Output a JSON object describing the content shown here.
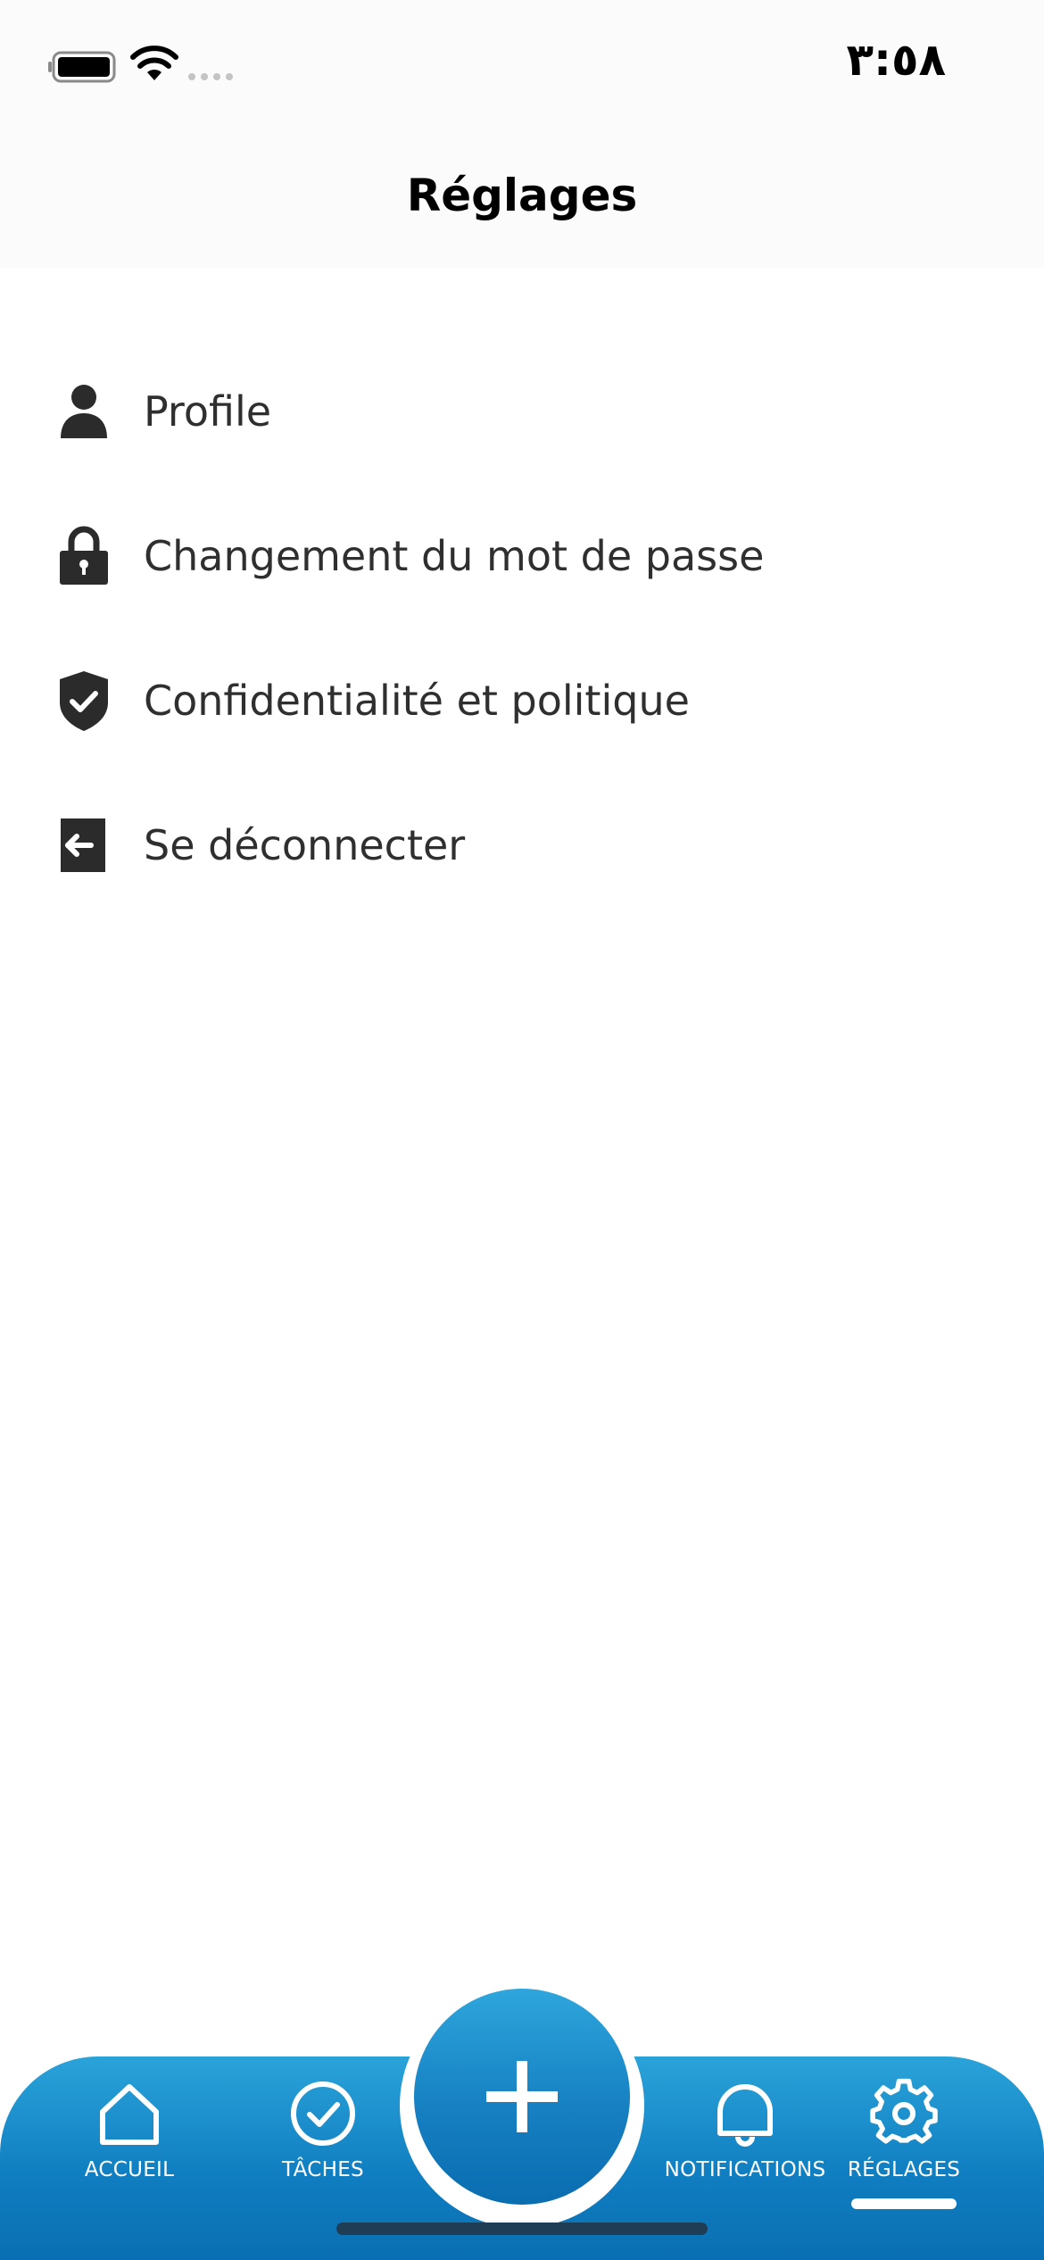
{
  "status_bar": {
    "time": "٣:٥٨"
  },
  "header": {
    "title": "Réglages"
  },
  "menu": {
    "items": [
      {
        "label": "Profile",
        "icon": "person-icon"
      },
      {
        "label": "Changement du mot de passe",
        "icon": "lock-icon"
      },
      {
        "label": "Confidentialité et politique",
        "icon": "shield-check-icon"
      },
      {
        "label": "Se déconnecter",
        "icon": "logout-icon"
      }
    ]
  },
  "tab_bar": {
    "tabs": [
      {
        "label": "ACCUEIL",
        "icon": "home-icon"
      },
      {
        "label": "TÂCHES",
        "icon": "check-circle-icon"
      },
      {
        "label": "NOTIFICATIONS",
        "icon": "bell-icon"
      },
      {
        "label": "RÉGLAGES",
        "icon": "gear-icon",
        "active": true
      }
    ],
    "fab_icon": "plus-icon"
  },
  "colors": {
    "accent": "#0f7dc0",
    "accent_light": "#2aa3d9",
    "text": "#2f2f2f",
    "icon": "#2b2b2b"
  }
}
